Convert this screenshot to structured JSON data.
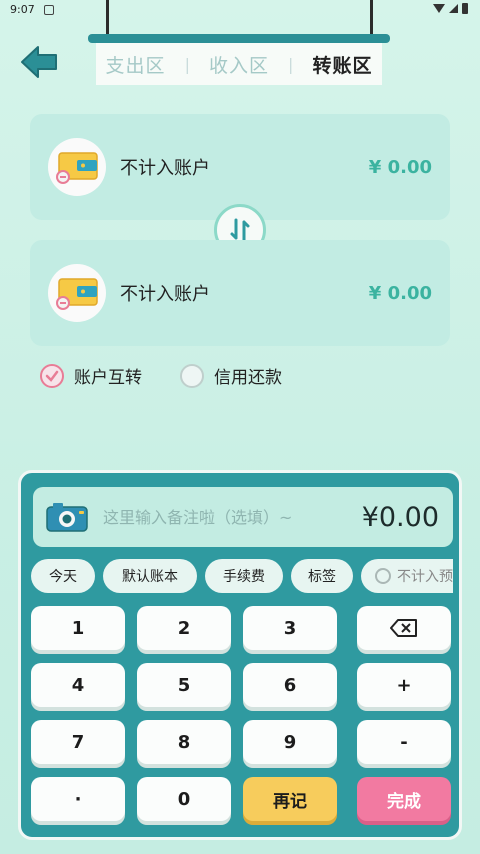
{
  "status_bar": {
    "time": "9:07"
  },
  "tabs": [
    {
      "label": "支出区",
      "active": false
    },
    {
      "label": "收入区",
      "active": false
    },
    {
      "label": "转账区",
      "active": true
    }
  ],
  "tab_separator": "|",
  "from_account": {
    "name": "不计入账户",
    "amount": "¥ 0.00"
  },
  "to_account": {
    "name": "不计入账户",
    "amount": "¥ 0.00"
  },
  "options": [
    {
      "label": "账户互转",
      "checked": true
    },
    {
      "label": "信用还款",
      "checked": false
    }
  ],
  "memo": {
    "placeholder": "这里输入备注啦（选填）~",
    "amount": "¥0.00"
  },
  "chips": [
    "今天",
    "默认账本",
    "手续费",
    "标签",
    "不计入预算"
  ],
  "keys": {
    "k1": "1",
    "k2": "2",
    "k3": "3",
    "k4": "4",
    "k5": "5",
    "k6": "6",
    "k7": "7",
    "k8": "8",
    "k9": "9",
    "dot": "·",
    "k0": "0",
    "plus": "+",
    "minus": "-",
    "again": "再记",
    "done": "完成"
  },
  "colors": {
    "accent": "#2f9aa0",
    "amount_green": "#3bb3a0",
    "done_pink": "#f27aa1",
    "again_yellow": "#f7cc5c"
  }
}
